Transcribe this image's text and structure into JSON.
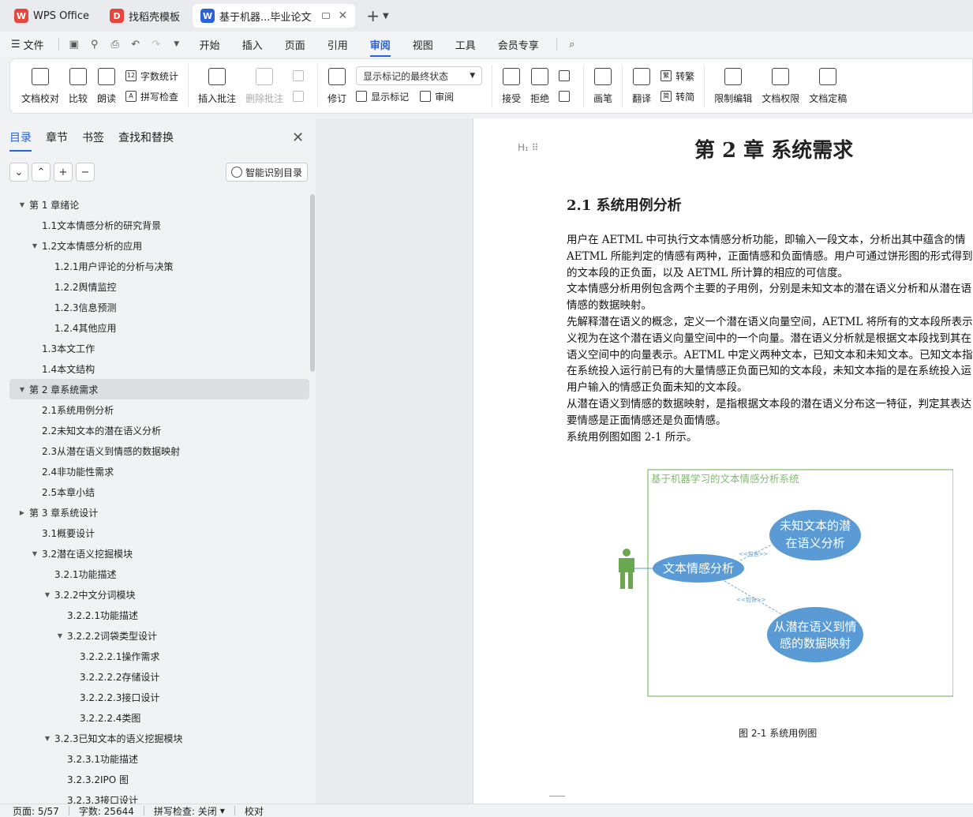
{
  "tabs": [
    {
      "label": "WPS Office",
      "logo": "W",
      "color": "#e8453c"
    },
    {
      "label": "找稻壳模板",
      "logo": "D",
      "color": "#e8453c"
    },
    {
      "label": "基于机器...毕业论文",
      "logo": "W",
      "color": "#2a63d9"
    }
  ],
  "menu": {
    "file": "文件",
    "tabs": [
      "开始",
      "插入",
      "页面",
      "引用",
      "审阅",
      "视图",
      "工具",
      "会员专享"
    ],
    "active": "审阅"
  },
  "ribbon": {
    "proofread": "文档校对",
    "compare": "比较",
    "read_aloud": "朗读",
    "word_count": "字数统计",
    "spell_check": "拼写检查",
    "insert_comment": "插入批注",
    "delete_comment": "删除批注",
    "revise": "修订",
    "markup_state": "显示标记的最终状态",
    "show_markup": "显示标记",
    "review": "审阅",
    "accept": "接受",
    "reject": "拒绝",
    "pen": "画笔",
    "translate": "翻译",
    "to_traditional": "转繁",
    "to_simplified": "转简",
    "restrict_edit": "限制编辑",
    "doc_permission": "文档权限",
    "doc_finalize": "文档定稿"
  },
  "pane": {
    "tabs": [
      "目录",
      "章节",
      "书签",
      "查找和替换"
    ],
    "smart_btn": "智能识别目录"
  },
  "toc": [
    {
      "text": "第 1 章绪论",
      "level": 0,
      "arrow": "▼"
    },
    {
      "text": "1.1文本情感分析的研究背景",
      "level": 1,
      "arrow": ""
    },
    {
      "text": "1.2文本情感分析的应用",
      "level": 1,
      "arrow": "▼"
    },
    {
      "text": "1.2.1用户评论的分析与决策",
      "level": 2,
      "arrow": ""
    },
    {
      "text": "1.2.2舆情监控",
      "level": 2,
      "arrow": ""
    },
    {
      "text": "1.2.3信息预测",
      "level": 2,
      "arrow": ""
    },
    {
      "text": "1.2.4其他应用",
      "level": 2,
      "arrow": ""
    },
    {
      "text": "1.3本文工作",
      "level": 1,
      "arrow": ""
    },
    {
      "text": "1.4本文结构",
      "level": 1,
      "arrow": ""
    },
    {
      "text": "第 2 章系统需求",
      "level": 0,
      "arrow": "▼",
      "selected": true
    },
    {
      "text": "2.1系统用例分析",
      "level": 1,
      "arrow": ""
    },
    {
      "text": "2.2未知文本的潜在语义分析",
      "level": 1,
      "arrow": ""
    },
    {
      "text": "2.3从潜在语义到情感的数据映射",
      "level": 1,
      "arrow": ""
    },
    {
      "text": "2.4非功能性需求",
      "level": 1,
      "arrow": ""
    },
    {
      "text": "2.5本章小结",
      "level": 1,
      "arrow": ""
    },
    {
      "text": "第 3 章系统设计",
      "level": 0,
      "arrow": "▶"
    },
    {
      "text": "3.1概要设计",
      "level": 1,
      "arrow": ""
    },
    {
      "text": "3.2潜在语义挖掘模块",
      "level": 1,
      "arrow": "▼"
    },
    {
      "text": "3.2.1功能描述",
      "level": 2,
      "arrow": ""
    },
    {
      "text": "3.2.2中文分词模块",
      "level": 2,
      "arrow": "▼"
    },
    {
      "text": "3.2.2.1功能描述",
      "level": 3,
      "arrow": ""
    },
    {
      "text": "3.2.2.2词袋类型设计",
      "level": 3,
      "arrow": "▼"
    },
    {
      "text": "3.2.2.2.1操作需求",
      "level": 4,
      "arrow": ""
    },
    {
      "text": "3.2.2.2.2存储设计",
      "level": 4,
      "arrow": ""
    },
    {
      "text": "3.2.2.2.3接口设计",
      "level": 4,
      "arrow": ""
    },
    {
      "text": "3.2.2.2.4类图",
      "level": 4,
      "arrow": ""
    },
    {
      "text": "3.2.3已知文本的语义挖掘模块",
      "level": 2,
      "arrow": "▼"
    },
    {
      "text": "3.2.3.1功能描述",
      "level": 3,
      "arrow": ""
    },
    {
      "text": "3.2.3.2IPO 图",
      "level": 3,
      "arrow": ""
    },
    {
      "text": "3.2.3.3接口设计",
      "level": 3,
      "arrow": ""
    }
  ],
  "doc": {
    "chapter": "第 2 章   系统需求",
    "section": "2.1  系统用例分析",
    "paragraphs": [
      "用户在 AETML 中可执行文本情感分析功能，即输入一段文本，分析出其中蕴含的情",
      "AETML 所能判定的情感有两种，正面情感和负面情感。用户可通过饼形图的形式得到",
      "的文本段的正负面，以及 AETML 所计算的相应的可信度。",
      "文本情感分析用例包含两个主要的子用例，分别是未知文本的潜在语义分析和从潜在语",
      "情感的数据映射。",
      "先解释潜在语义的概念，定义一个潜在语义向量空间，AETML 将所有的文本段所表示",
      "义视为在这个潜在语义向量空间中的一个向量。潜在语义分析就是根据文本段找到其在",
      "语义空间中的向量表示。AETML 中定义两种文本，已知文本和未知文本。已知文本指",
      "在系统投入运行前已有的大量情感正负面已知的文本段，未知文本指的是在系统投入运",
      "用户输入的情感正负面未知的文本段。",
      "从潜在语义到情感的数据映射，是指根据文本段的潜在语义分布这一特征，判定其表达",
      "要情感是正面情感还是负面情感。",
      "系统用例图如图 2-1 所示。"
    ],
    "diagram": {
      "system_title": "基于机器学习的文本情感分析系统",
      "main_usecase": "文本情感分析",
      "usecase_top_l1": "未知文本的潜",
      "usecase_top_l2": "在语义分析",
      "usecase_bottom_l1": "从潜在语义到情",
      "usecase_bottom_l2": "感的数据映射",
      "include_label": "<<包含>>"
    },
    "caption": "图  2-1    系统用例图"
  },
  "status": {
    "page": "页面: 5/57",
    "words": "字数: 25644",
    "spell": "拼写检查: 关闭",
    "proof": "校对"
  }
}
